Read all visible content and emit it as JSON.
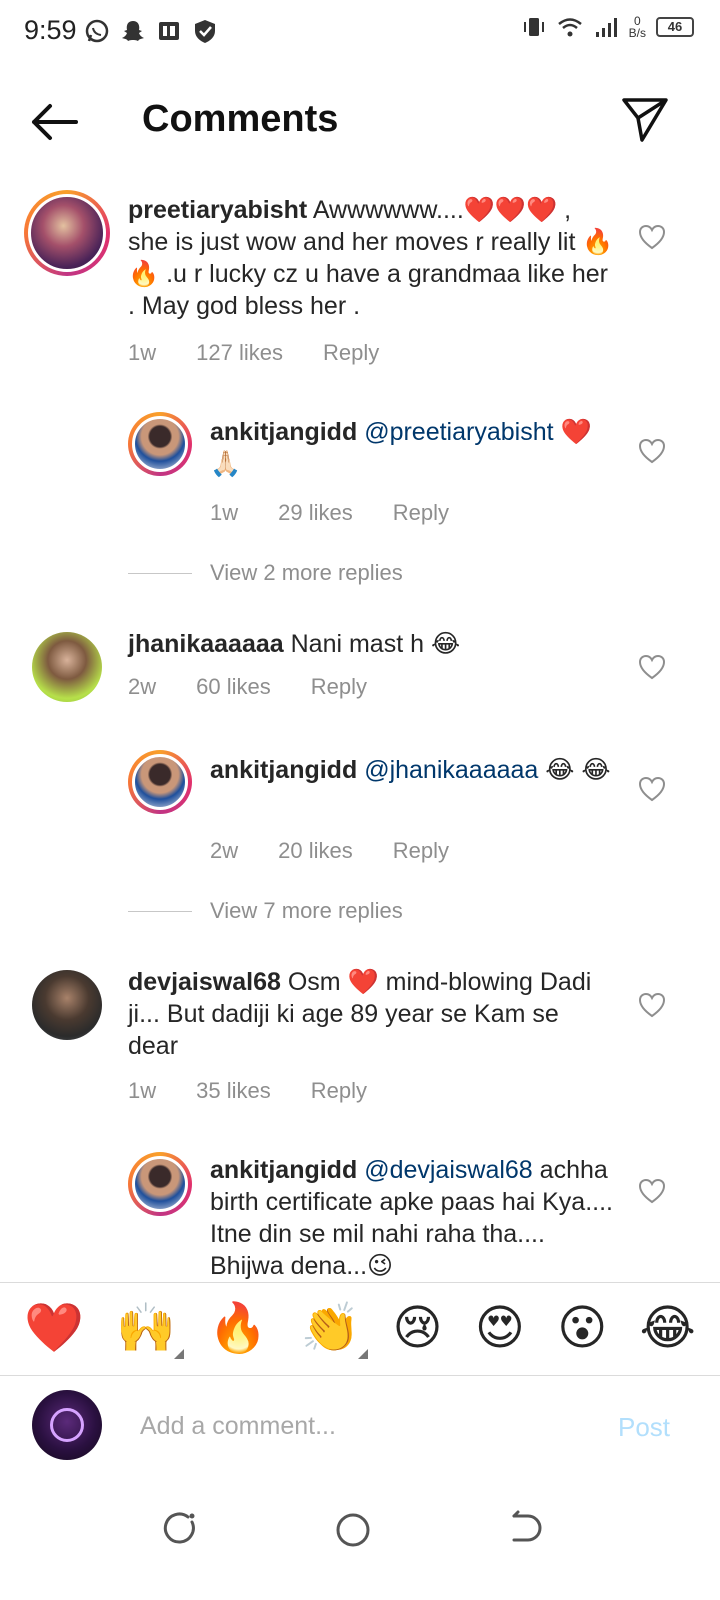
{
  "status_bar": {
    "time": "9:59",
    "net_speed_top": "0",
    "net_speed_unit": "B/s",
    "battery_level": "46",
    "left_icons": [
      "whatsapp-icon",
      "snapchat-icon",
      "paytm-icon",
      "shield-icon"
    ],
    "right_icons": [
      "vibrate-icon",
      "wifi-icon",
      "signal-icon",
      "battery-icon"
    ]
  },
  "header": {
    "title": "Comments",
    "back_icon": "arrow-left-icon",
    "share_icon": "paper-plane-icon"
  },
  "comments": [
    {
      "username": "preetiaryabisht",
      "text": "Awwwwww....❤️❤️❤️ , she is just wow and her moves r really lit 🔥🔥 .u r lucky cz u have a grandmaa like her . May god bless her .",
      "time": "1w",
      "likes": "127 likes",
      "reply": "Reply"
    },
    {
      "username": "ankitjangidd",
      "mention": "@preetiaryabisht",
      "text": " ❤️ 🙏🏻",
      "time": "1w",
      "likes": "29 likes",
      "reply": "Reply",
      "is_reply": true
    },
    {
      "view_more": "View 2 more replies"
    },
    {
      "username": "jhanikaaaaaa",
      "text": "Nani mast h 😂",
      "time": "2w",
      "likes": "60 likes",
      "reply": "Reply"
    },
    {
      "username": "ankitjangidd",
      "mention": "@jhanikaaaaaa",
      "text": " 😂 😂",
      "time": "2w",
      "likes": "20 likes",
      "reply": "Reply",
      "is_reply": true
    },
    {
      "view_more": "View 7 more replies"
    },
    {
      "username": "devjaiswal68",
      "text": "Osm ❤️ mind-blowing Dadi ji... But dadiji ki age 89 year se Kam se dear",
      "time": "1w",
      "likes": "35 likes",
      "reply": "Reply"
    },
    {
      "username": "ankitjangidd",
      "mention": "@devjaiswal68",
      "text": " achha birth certificate apke paas hai Kya.... Itne din se mil nahi raha tha.... Bhijwa dena...😉",
      "is_reply": true
    }
  ],
  "emoji_bar": [
    "❤️",
    "🙌",
    "🔥",
    "👏",
    "😢",
    "😍",
    "😮",
    "😂"
  ],
  "compose": {
    "placeholder": "Add a comment...",
    "post_label": "Post"
  },
  "colors": {
    "text": "#262626",
    "meta": "#8e8e8e",
    "mention": "#00376b",
    "post_disabled": "#b2dffc",
    "divider": "#dbdbdb"
  }
}
